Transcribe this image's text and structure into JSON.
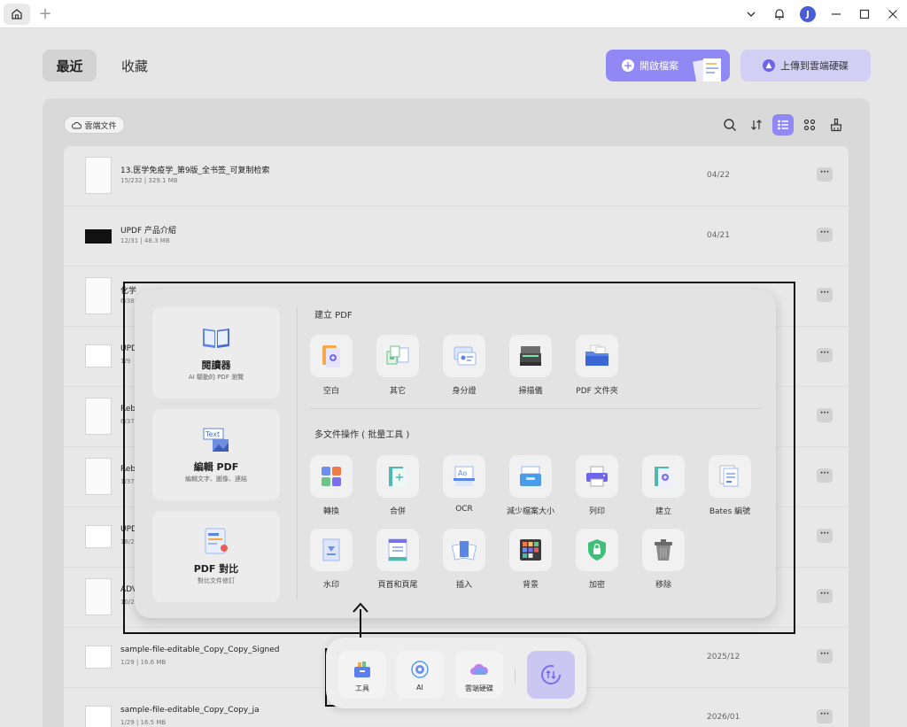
{
  "header": {
    "tab_recent": "最近",
    "tab_favorites": "收藏",
    "open_file": "開啟檔案",
    "upload_cloud": "上傳到雲端硬碟"
  },
  "cloud_chip": "雲端文件",
  "files": [
    {
      "name": "13.医学免疫学_第9版_全书签_可复制检索",
      "meta": "15/232 | 329.1 MB",
      "date": "04/22"
    },
    {
      "name": "UPDF 产品介紹",
      "meta": "12/31 | 48.3 MB",
      "date": "04/21"
    },
    {
      "name": "化学",
      "meta": "6/38",
      "date": ""
    },
    {
      "name": "UPD",
      "meta": "1/9",
      "date": ""
    },
    {
      "name": "Reb",
      "meta": "6/37",
      "date": ""
    },
    {
      "name": "Reb",
      "meta": "1/37",
      "date": ""
    },
    {
      "name": "UPD",
      "meta": "18/2",
      "date": ""
    },
    {
      "name": "ADV",
      "meta": "10/2",
      "date": ""
    },
    {
      "name": "sample-file-editable_Copy_Copy_Signed",
      "meta": "1/29 | 16.6 MB",
      "date": "2025/12"
    },
    {
      "name": "sample-file-editable_Copy_Copy_ja",
      "meta": "1/29 | 16.5 MB",
      "date": "2026/01"
    }
  ],
  "popup": {
    "side": [
      {
        "title": "閱讀器",
        "sub": "AI 驅動的 PDF 瀏覽"
      },
      {
        "title": "編輯 PDF",
        "sub": "編輯文字、圖像、連結"
      },
      {
        "title": "PDF 對比",
        "sub": "對比文件修訂"
      }
    ],
    "create_title": "建立 PDF",
    "create_tools": [
      "空白",
      "其它",
      "身分證",
      "掃描儀",
      "PDF 文件夾"
    ],
    "batch_title": "多文件操作 ( 批量工具 )",
    "batch_tools_row1": [
      "轉換",
      "合併",
      "OCR",
      "減少檔案大小",
      "列印",
      "建立",
      "Bates 編號"
    ],
    "batch_tools_row2": [
      "水印",
      "頁首和頁尾",
      "插入",
      "背景",
      "加密",
      "移除"
    ]
  },
  "dock": {
    "tools": "工具",
    "ai": "AI",
    "cloud": "雲端硬碟"
  },
  "colors": {
    "accent": "#8f88f5",
    "accent_light": "#d2cff5"
  }
}
